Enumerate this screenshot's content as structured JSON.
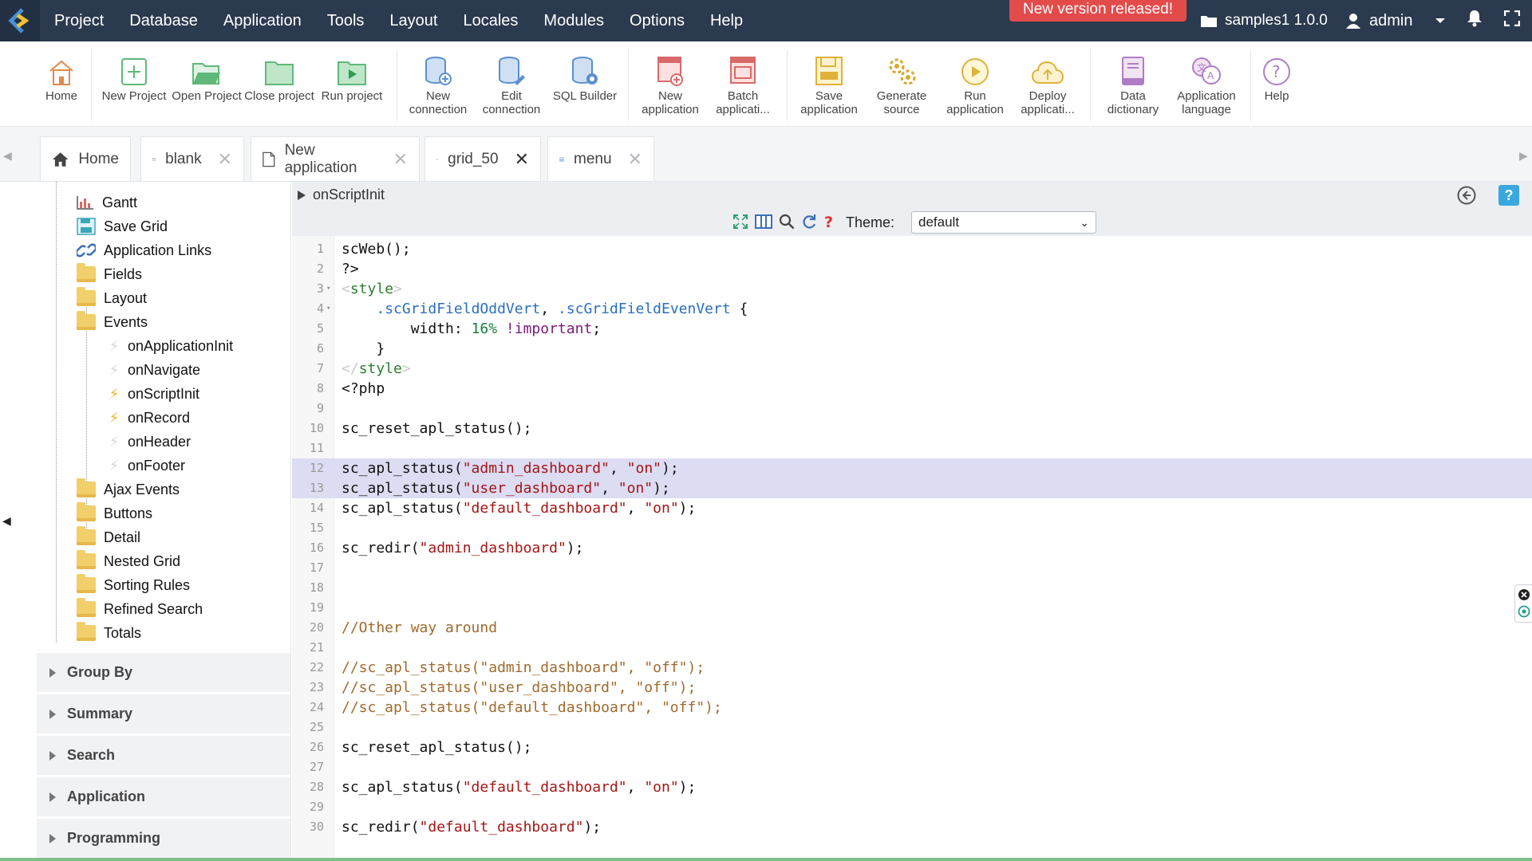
{
  "menubar": {
    "items": [
      "Project",
      "Database",
      "Application",
      "Tools",
      "Layout",
      "Locales",
      "Modules",
      "Options",
      "Help"
    ],
    "new_version": "New version released!",
    "project": "samples1 1.0.0",
    "user": "admin"
  },
  "toolbar": {
    "tools": [
      {
        "label": "Home",
        "icon": "home-icon"
      },
      {
        "label": "New Project",
        "icon": "new-project-icon"
      },
      {
        "label": "Open Project",
        "icon": "open-project-icon"
      },
      {
        "label": "Close project",
        "icon": "close-project-icon"
      },
      {
        "label": "Run project",
        "icon": "run-project-icon"
      },
      {
        "label": "New connection",
        "icon": "new-connection-icon"
      },
      {
        "label": "Edit connection",
        "icon": "edit-connection-icon"
      },
      {
        "label": "SQL Builder",
        "icon": "sql-builder-icon"
      },
      {
        "label": "New application",
        "icon": "new-application-icon"
      },
      {
        "label": "Batch applicati...",
        "icon": "batch-application-icon"
      },
      {
        "label": "Save application",
        "icon": "save-application-icon"
      },
      {
        "label": "Generate source",
        "icon": "generate-source-icon"
      },
      {
        "label": "Run application",
        "icon": "run-application-icon"
      },
      {
        "label": "Deploy applicati...",
        "icon": "deploy-application-icon"
      },
      {
        "label": "Data dictionary",
        "icon": "data-dictionary-icon"
      },
      {
        "label": "Application language",
        "icon": "application-language-icon"
      },
      {
        "label": "Help",
        "icon": "help-icon"
      }
    ]
  },
  "tabs": [
    {
      "label": "Home",
      "icon": "home-icon",
      "closable": false
    },
    {
      "label": "blank",
      "icon": "code-file-icon",
      "closable": true
    },
    {
      "label": "New application",
      "icon": "document-icon",
      "closable": true
    },
    {
      "label": "grid_50",
      "icon": "grid-icon",
      "closable": true,
      "active": true
    },
    {
      "label": "menu",
      "icon": "menu-list-icon",
      "closable": true
    }
  ],
  "tree": {
    "items": [
      {
        "label": "Gantt",
        "icon": "gantt-chart-icon"
      },
      {
        "label": "Save Grid",
        "icon": "save-grid-icon"
      },
      {
        "label": "Application Links",
        "icon": "link-icon"
      },
      {
        "label": "Fields",
        "icon": "folder-icon"
      },
      {
        "label": "Layout",
        "icon": "folder-icon"
      },
      {
        "label": "Events",
        "icon": "folder-icon"
      },
      {
        "label": "onApplicationInit",
        "icon": "bolt-icon"
      },
      {
        "label": "onNavigate",
        "icon": "bolt-icon"
      },
      {
        "label": "onScriptInit",
        "icon": "bolt-icon",
        "active": true
      },
      {
        "label": "onRecord",
        "icon": "bolt-icon",
        "active": true
      },
      {
        "label": "onHeader",
        "icon": "bolt-icon"
      },
      {
        "label": "onFooter",
        "icon": "bolt-icon"
      },
      {
        "label": "Ajax Events",
        "icon": "folder-icon"
      },
      {
        "label": "Buttons",
        "icon": "folder-icon"
      },
      {
        "label": "Detail",
        "icon": "folder-icon"
      },
      {
        "label": "Nested Grid",
        "icon": "folder-icon"
      },
      {
        "label": "Sorting Rules",
        "icon": "folder-icon"
      },
      {
        "label": "Refined Search",
        "icon": "folder-icon"
      },
      {
        "label": "Totals",
        "icon": "folder-icon"
      }
    ],
    "sections": [
      "Group By",
      "Summary",
      "Search",
      "Application",
      "Programming"
    ]
  },
  "editor": {
    "event_title": "onScriptInit",
    "theme_label": "Theme:",
    "theme_value": "default",
    "highlight_color": "#dcdcf3",
    "lines": [
      "scWeb();",
      "?>",
      "<style>",
      "    .scGridFieldOddVert, .scGridFieldEvenVert {",
      "        width: 16% !important;",
      "    }",
      "</style>",
      "<?php",
      "",
      "sc_reset_apl_status();",
      "",
      "sc_apl_status(\"admin_dashboard\", \"on\");",
      "sc_apl_status(\"user_dashboard\", \"on\");",
      "sc_apl_status(\"default_dashboard\", \"on\");",
      "",
      "sc_redir(\"admin_dashboard\");",
      "",
      "",
      "",
      "//Other way around",
      "",
      "//sc_apl_status(\"admin_dashboard\", \"off\");",
      "//sc_apl_status(\"user_dashboard\", \"off\");",
      "//sc_apl_status(\"default_dashboard\", \"off\");",
      "",
      "sc_reset_apl_status();",
      "",
      "sc_apl_status(\"default_dashboard\", \"on\");",
      "",
      "sc_redir(\"default_dashboard\");"
    ]
  }
}
